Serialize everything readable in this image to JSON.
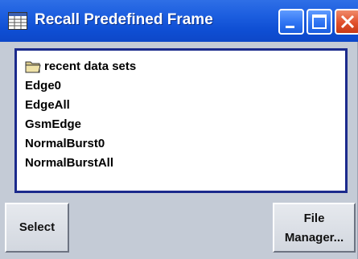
{
  "window": {
    "title": "Recall Predefined Frame",
    "title_icon": "table-icon",
    "controls": [
      "minimize-icon",
      "maximize-icon",
      "close-icon"
    ]
  },
  "list": {
    "items": [
      {
        "label": "recent data sets",
        "icon": "folder-icon"
      },
      {
        "label": "Edge0"
      },
      {
        "label": "EdgeAll"
      },
      {
        "label": "GsmEdge"
      },
      {
        "label": "NormalBurst0"
      },
      {
        "label": "NormalBurstAll"
      }
    ]
  },
  "buttons": {
    "select_label": "Select",
    "file_manager_line1": "File",
    "file_manager_line2": "Manager..."
  },
  "colors": {
    "titlebar": "#0f4fd4",
    "list_border": "#1b2a8c",
    "background": "#c4cbd6",
    "close_button": "#e0502c"
  }
}
